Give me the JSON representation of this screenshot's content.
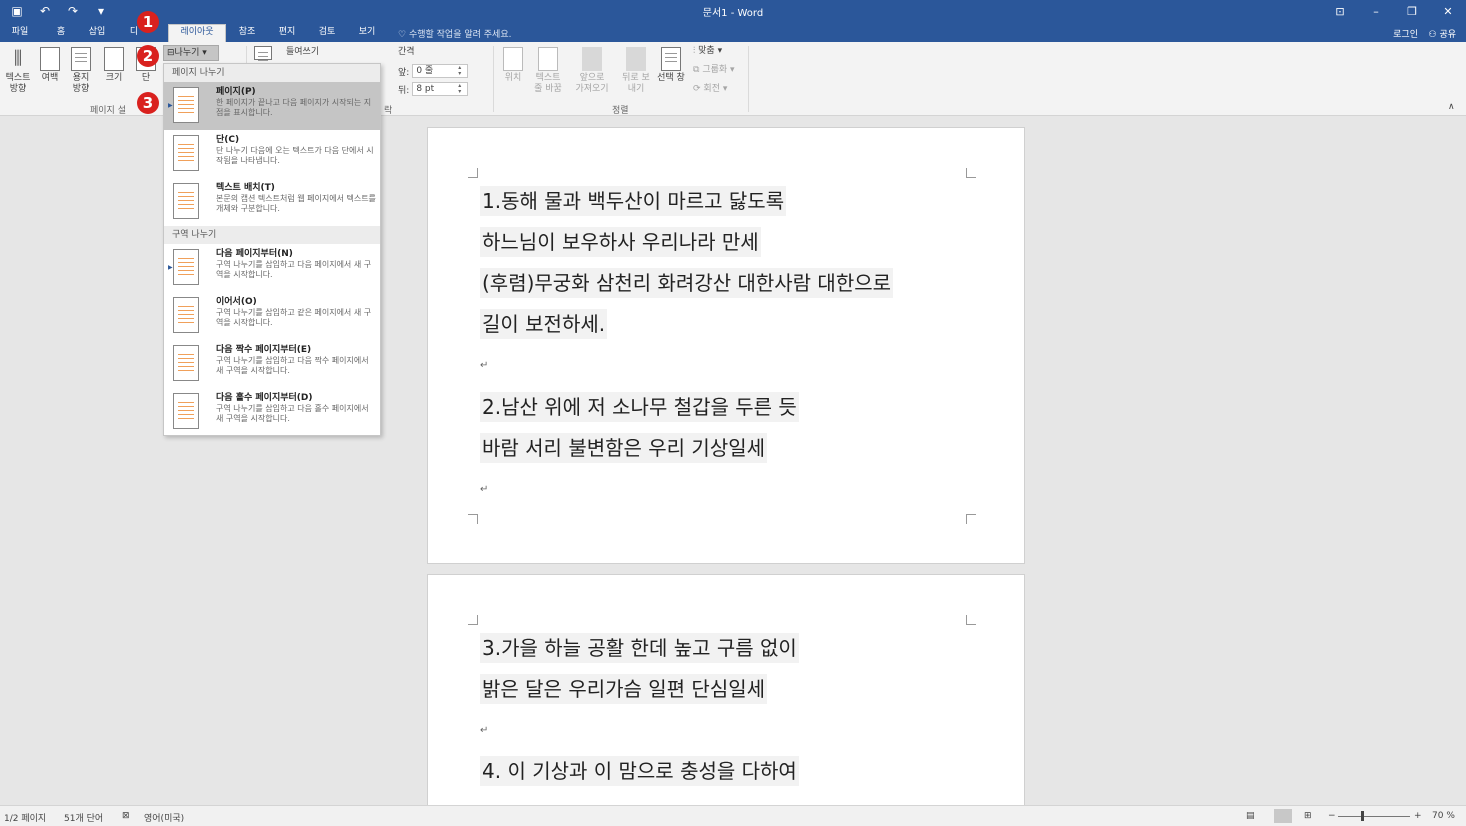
{
  "window": {
    "title": "문서1 - Word",
    "qat": [
      "save-icon",
      "undo-icon",
      "redo-icon",
      "customize-icon"
    ]
  },
  "tabs": [
    {
      "label": "파일"
    },
    {
      "label": "홈"
    },
    {
      "label": "삽입"
    },
    {
      "label": "디"
    },
    {
      "label": "레이아웃"
    },
    {
      "label": "참조"
    },
    {
      "label": "편지"
    },
    {
      "label": "검토"
    },
    {
      "label": "보기"
    }
  ],
  "tell_me": "수행할 작업을 알려 주세요.",
  "account": {
    "signin": "로그인",
    "share": "공유"
  },
  "ribbon": {
    "page_setup": {
      "text_direction": "텍스트 방향",
      "margins": "여백",
      "orientation": "용지 방향",
      "size": "크기",
      "columns": "단",
      "group_label": "페이지 설"
    },
    "breaks_label": "나누기",
    "indent_label": "들여쓰기",
    "spacing": {
      "title": "간격",
      "before_label": "앞:",
      "before_value": "0 줄",
      "after_label": "뒤:",
      "after_value": "8 pt"
    },
    "paragraph_group_tail": "락",
    "arrange": {
      "position": "위치",
      "wrap_text": "텍스트 줄 바꿈",
      "bring_forward": "앞으로 가져오기",
      "send_backward": "뒤로 보내기",
      "selection_pane": "선택 창",
      "align": "맞춤",
      "group": "그룹화",
      "rotate": "회전",
      "group_label": "정렬"
    }
  },
  "dropdown": {
    "page_breaks_header": "페이지 나누기",
    "section_breaks_header": "구역 나누기",
    "page_items": [
      {
        "title": "페이지(P)",
        "desc": "한 페이지가 끝나고 다음 페이지가 시작되는 지점을 표시합니다."
      },
      {
        "title": "단(C)",
        "desc": "단 나누기 다음에 오는 텍스트가 다음 단에서 시작됨을 나타냅니다."
      },
      {
        "title": "텍스트 배치(T)",
        "desc": "본문의 캡션 텍스트처럼 웹 페이지에서 텍스트를 개체와 구분합니다."
      }
    ],
    "section_items": [
      {
        "title": "다음 페이지부터(N)",
        "desc": "구역 나누기를 삽입하고 다음 페이지에서 새 구역을 시작합니다."
      },
      {
        "title": "이어서(O)",
        "desc": "구역 나누기를 삽입하고 같은 페이지에서 새 구역을 시작합니다."
      },
      {
        "title": "다음 짝수 페이지부터(E)",
        "desc": "구역 나누기를 삽입하고 다음 짝수 페이지에서 새 구역을 시작합니다."
      },
      {
        "title": "다음 홀수 페이지부터(D)",
        "desc": "구역 나누기를 삽입하고 다음 홀수 페이지에서 새 구역을 시작합니다."
      }
    ]
  },
  "badges": [
    "1",
    "2",
    "3"
  ],
  "document": {
    "page1": [
      "1.동해 물과 백두산이 마르고 닳도록",
      "하느님이 보우하사 우리나라 만세",
      "(후렴)무궁화 삼천리 화려강산 대한사람 대한으로",
      "길이 보전하세.",
      "2.남산 위에 저 소나무 철갑을 두른 듯",
      "바람 서리 불변함은 우리 기상일세"
    ],
    "page2": [
      "3.가을 하늘 공활 한데 높고 구름 없이",
      "밝은 달은 우리가슴 일편 단심일세",
      "4. 이 기상과 이 맘으로 충성을 다하여"
    ]
  },
  "status": {
    "page": "1/2 페이지",
    "words": "51개 단어",
    "language": "영어(미국)",
    "zoom": "70 %"
  }
}
